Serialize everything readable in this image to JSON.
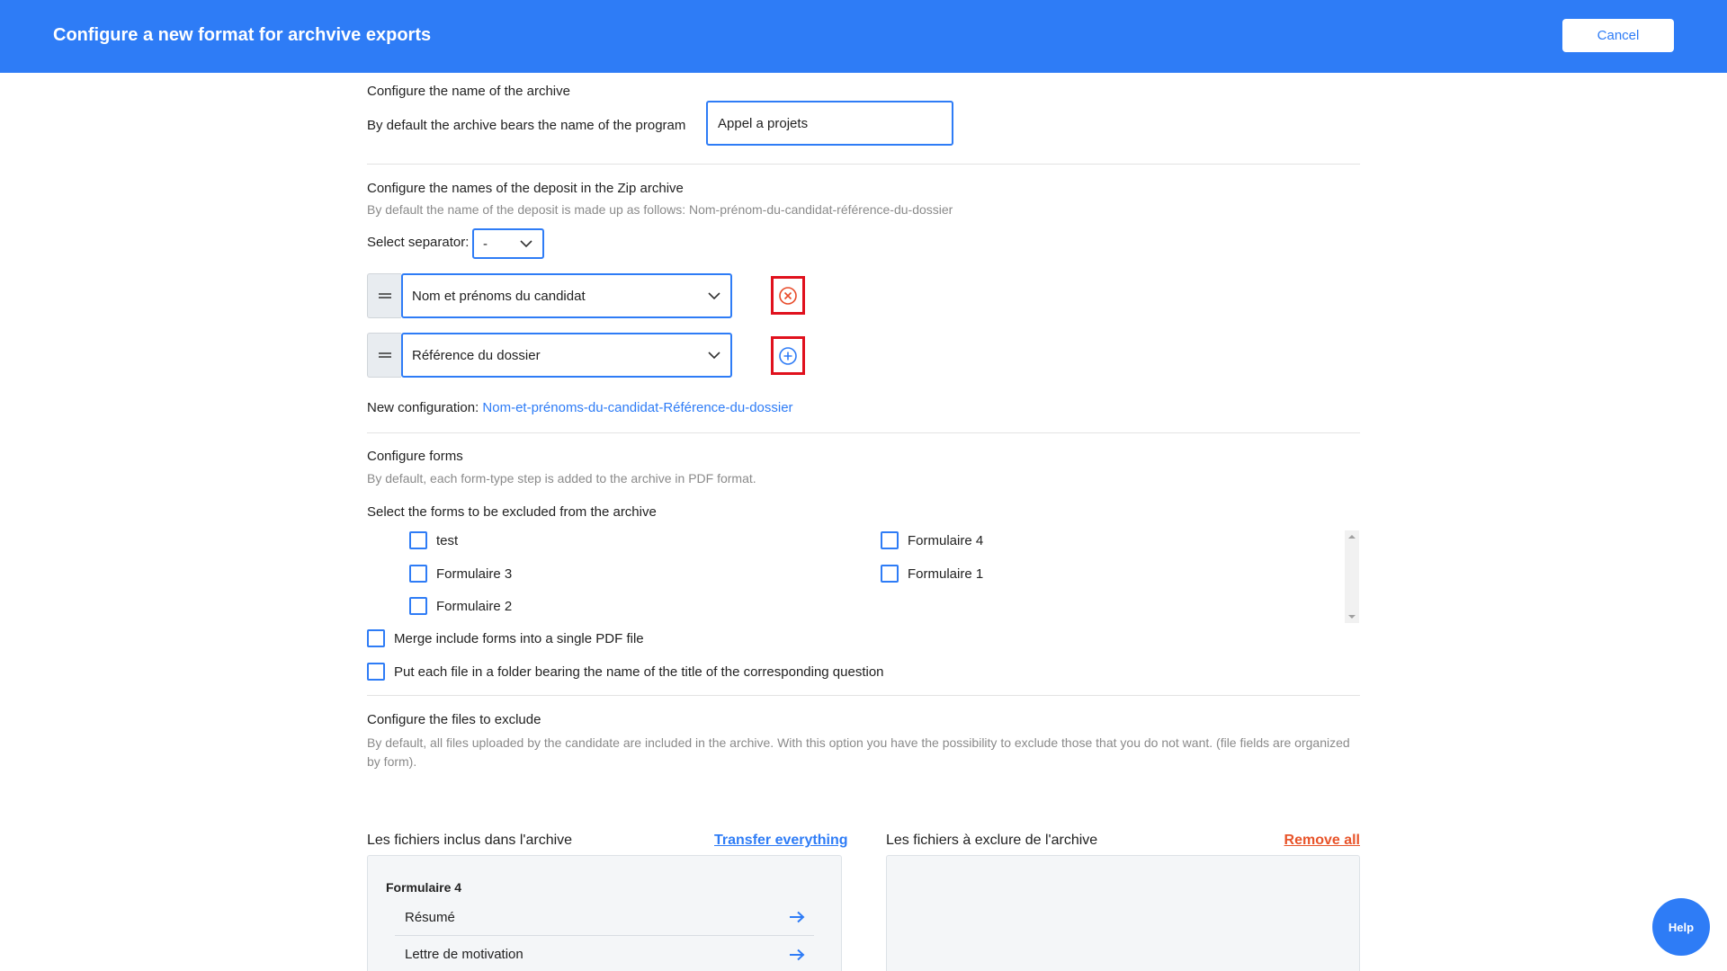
{
  "header": {
    "title": "Configure a new format for archvive exports",
    "cancel_label": "Cancel"
  },
  "archive_name": {
    "section_title": "Configure the name of the archive",
    "description": "By default the archive bears the name of the program",
    "input_value": "Appel a projets"
  },
  "deposit_names": {
    "section_title": "Configure the names of the deposit in the Zip archive",
    "description": "By default the name of the deposit is made up as follows: Nom-prénom-du-candidat-référence-du-dossier",
    "separator_label": "Select separator:",
    "separator_value": "-",
    "fields": [
      {
        "value": "Nom et prénoms du candidat",
        "action": "remove-circle-icon"
      },
      {
        "value": "Référence du dossier",
        "action": "add-circle-icon"
      }
    ],
    "new_config_label": "New configuration:",
    "new_config_value": "Nom-et-prénoms-du-candidat-Référence-du-dossier"
  },
  "forms": {
    "section_title": "Configure forms",
    "description": "By default, each form-type step is added to the archive in PDF format.",
    "exclude_label": "Select the forms to be excluded from the archive",
    "left_column": [
      "test",
      "Formulaire 3",
      "Formulaire 2"
    ],
    "right_column": [
      "Formulaire 4",
      "Formulaire 1"
    ],
    "merge_option": "Merge include forms into a single PDF file",
    "folder_option": "Put each file in a folder bearing the name of the title of the corresponding question"
  },
  "files_exclude": {
    "section_title": "Configure the files to exclude",
    "description": "By default, all files uploaded by the candidate are included in the archive. With this option you have the possibility to exclude those that you do not want. (file fields are organized by form).",
    "included_title": "Les fichiers inclus dans l'archive",
    "transfer_label": "Transfer everything",
    "excluded_title": "Les fichiers à exclure de l'archive",
    "remove_label": "Remove all",
    "group_title": "Formulaire 4",
    "files": [
      "Résumé",
      "Lettre de motivation"
    ]
  },
  "help_label": "Help",
  "colors": {
    "primary": "#2e7cf6",
    "remove_red": "#e84b2a",
    "highlight_red": "#e0111d"
  }
}
